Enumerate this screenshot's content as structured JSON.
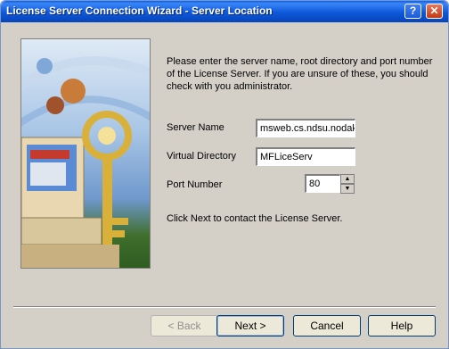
{
  "window": {
    "title": "License Server Connection Wizard - Server Location"
  },
  "titlebar": {
    "help_glyph": "?",
    "close_glyph": "✕"
  },
  "intro": {
    "line1": "Please enter the server name, root directory and port number",
    "line2": "of the License Server. If you are unsure of these, you should",
    "line3": "check with you administrator."
  },
  "form": {
    "server_name_label": "Server Name",
    "server_name_value": "msweb.cs.ndsu.nodak",
    "virtual_dir_label": "Virtual Directory",
    "virtual_dir_value": "MFLiceServ",
    "port_label": "Port Number",
    "port_value": "80"
  },
  "hint": "Click Next to contact the License Server.",
  "buttons": {
    "back": "< Back",
    "next": "Next >",
    "cancel": "Cancel",
    "help": "Help"
  },
  "icons": {
    "wizard_picture": "key-and-computer-illustration",
    "spin_up": "▲",
    "spin_down": "▼"
  }
}
